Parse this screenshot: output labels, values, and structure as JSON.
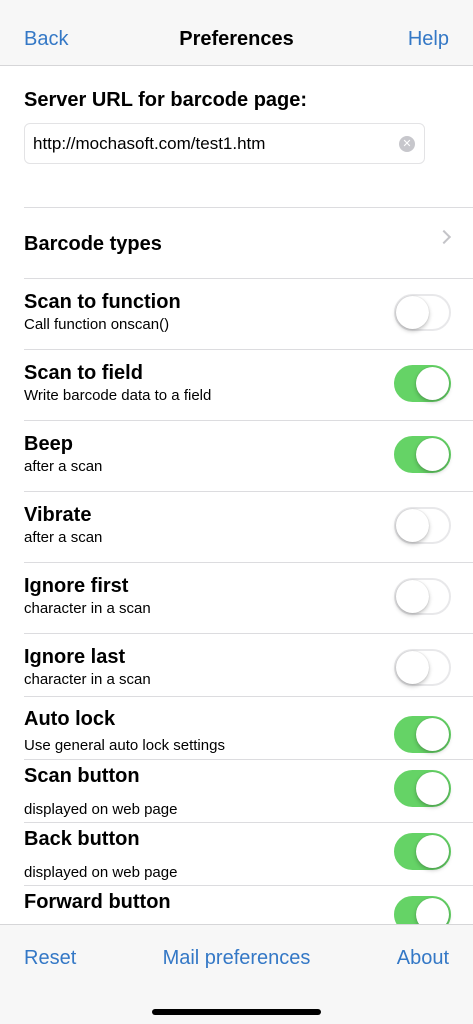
{
  "nav": {
    "back_label": "Back",
    "title": "Preferences",
    "help_label": "Help"
  },
  "server": {
    "label": "Server URL for barcode page:",
    "url_value": "http://mochasoft.com/test1.htm"
  },
  "barcode_types": {
    "label": "Barcode types"
  },
  "settings": [
    {
      "title": "Scan to function",
      "subtitle": "Call function onscan()",
      "enabled": false
    },
    {
      "title": "Scan to field",
      "subtitle": "Write barcode data to a field",
      "enabled": true
    },
    {
      "title": "Beep",
      "subtitle": "after a scan",
      "enabled": true
    },
    {
      "title": "Vibrate",
      "subtitle": "after a scan",
      "enabled": false
    },
    {
      "title": "Ignore first",
      "subtitle": "character in a scan",
      "enabled": false
    },
    {
      "title": "Ignore last",
      "subtitle": "character in a scan",
      "enabled": false
    },
    {
      "title": "Auto lock",
      "subtitle": "Use general auto lock settings",
      "enabled": true
    },
    {
      "title": "Scan button",
      "subtitle": "displayed on web page",
      "enabled": true
    },
    {
      "title": "Back button",
      "subtitle": "displayed on web page",
      "enabled": true
    },
    {
      "title": "Forward button",
      "subtitle": "",
      "enabled": true
    }
  ],
  "toolbar": {
    "reset_label": "Reset",
    "mail_label": "Mail preferences",
    "about_label": "About"
  },
  "colors": {
    "accent": "#3478c6",
    "toggle_on": "#65d366"
  }
}
